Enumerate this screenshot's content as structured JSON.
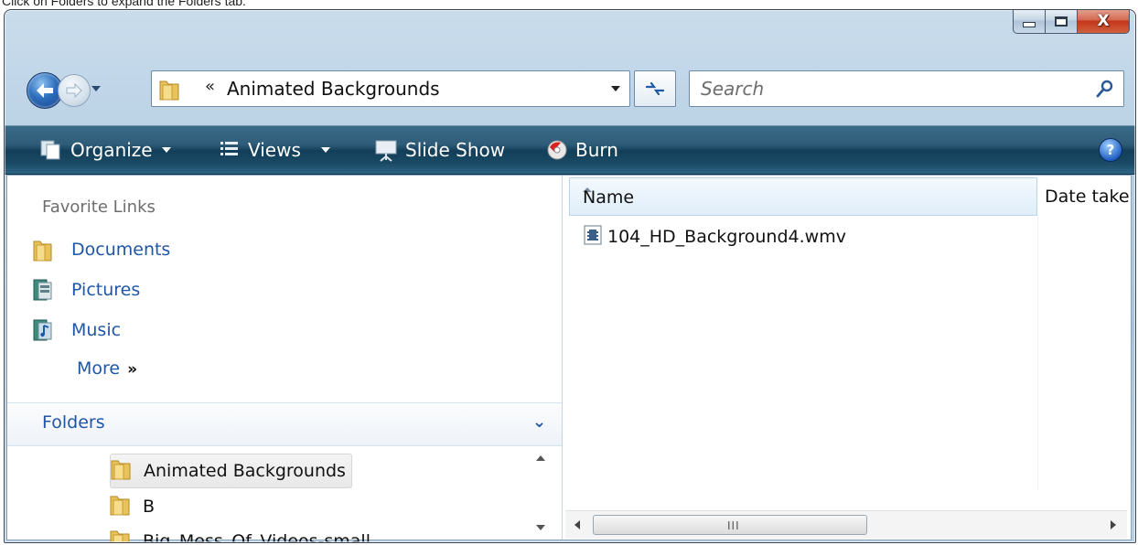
{
  "caption": "Click on Folders to expand the Folders tab.",
  "window": {
    "controls": {
      "minimize_icon": "minimize-icon",
      "maximize_icon": "maximize-icon",
      "close_label": "X"
    }
  },
  "navigation": {
    "address_chevron": "«",
    "address_path": "Animated Backgrounds",
    "search_placeholder": "Search"
  },
  "toolbar": {
    "organize_label": "Organize",
    "views_label": "Views",
    "slideshow_label": "Slide Show",
    "burn_label": "Burn",
    "help_label": "?"
  },
  "nav_pane": {
    "favorite_links_title": "Favorite Links",
    "favorites": [
      {
        "label": "Documents",
        "icon": "documents-folder-icon"
      },
      {
        "label": "Pictures",
        "icon": "pictures-icon"
      },
      {
        "label": "Music",
        "icon": "music-icon"
      }
    ],
    "more_label": "More",
    "more_chevron": "»",
    "folders_title": "Folders",
    "folders_chevron": "⌄",
    "tree": [
      {
        "label": "Animated Backgrounds",
        "selected": true
      },
      {
        "label": "B",
        "selected": false
      },
      {
        "label": "Big_Mess_Of_Videos-small",
        "selected": false
      }
    ]
  },
  "file_list": {
    "columns": {
      "name": "Name",
      "date_taken": "Date taken"
    },
    "files": [
      {
        "name": "104_HD_Background4.wmv",
        "icon": "video-file-icon"
      }
    ],
    "scroll_grip": "III"
  },
  "colors": {
    "toolbar": "#1a4a65",
    "link_blue": "#1f56a6",
    "close_red": "#c3361b"
  }
}
